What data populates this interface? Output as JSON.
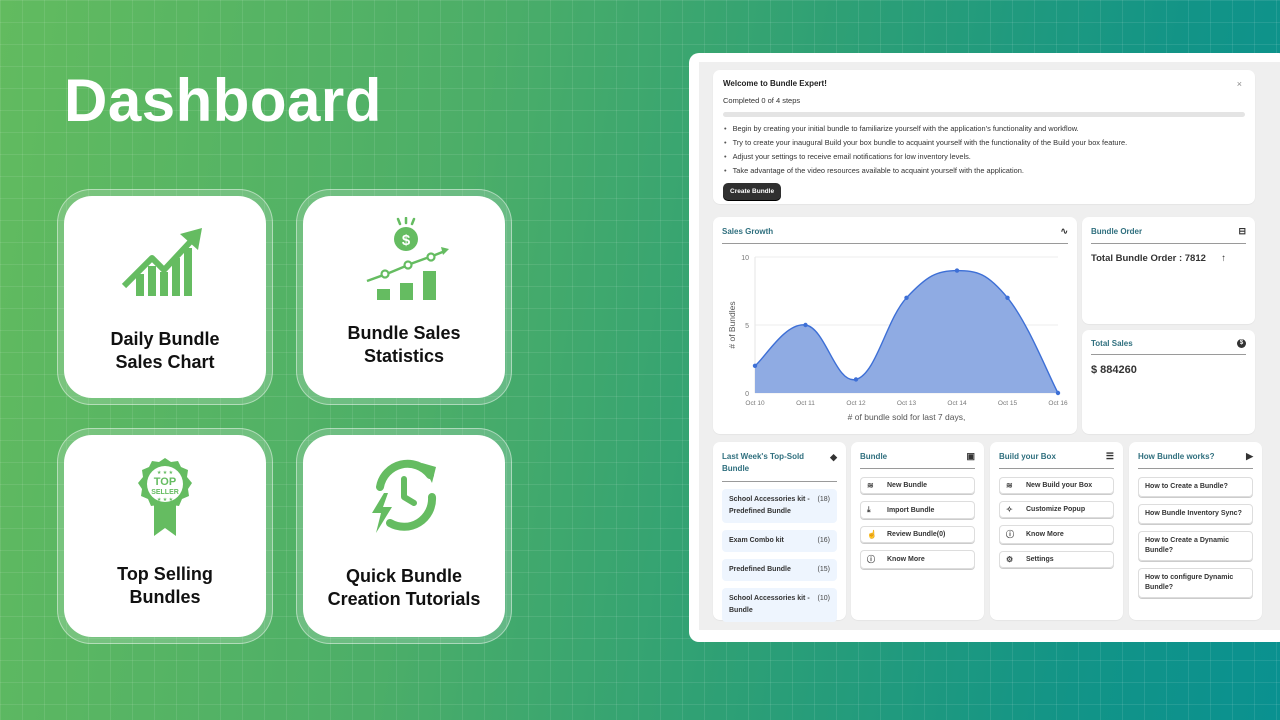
{
  "page": {
    "title": "Dashboard"
  },
  "features": [
    {
      "label_line1": "Daily Bundle",
      "label_line2": "Sales Chart",
      "icon": "growth-chart-icon"
    },
    {
      "label_line1": "Bundle Sales",
      "label_line2": "Statistics",
      "icon": "sales-statistics-icon"
    },
    {
      "label_line1": "Top Selling",
      "label_line2": "Bundles",
      "icon": "top-seller-badge-icon"
    },
    {
      "label_line1": "Quick Bundle",
      "label_line2": "Creation Tutorials",
      "icon": "quick-refresh-icon"
    }
  ],
  "welcome": {
    "title": "Welcome to Bundle Expert!",
    "close_icon": "×",
    "progress_label": "Completed 0 of 4 steps",
    "progress_value": 0,
    "steps": [
      "Begin by creating your initial bundle to familiarize yourself with the application's functionality and workflow.",
      "Try to create your inaugural Build your box bundle to acquaint yourself with the functionality of the Build your box feature.",
      "Adjust your settings to receive email notifications for low inventory levels.",
      "Take advantage of the video resources available to acquaint yourself with the application."
    ],
    "button_label": "Create Bundle"
  },
  "sales_growth": {
    "title": "Sales Growth",
    "icon": "line-chart-icon"
  },
  "chart_data": {
    "type": "area",
    "title": "Sales Growth",
    "categories": [
      "Oct 10",
      "Oct 11",
      "Oct 12",
      "Oct 13",
      "Oct 14",
      "Oct 15",
      "Oct 16"
    ],
    "series": [
      {
        "name": "# of Bundles",
        "values": [
          2,
          5,
          1,
          7,
          9,
          7,
          0
        ],
        "color": "#3d6fd6",
        "fill": "#8fabe3"
      }
    ],
    "xlabel": "# of bundle sold for last 7 days,",
    "ylabel": "# of Bundles",
    "ylim": [
      0,
      10
    ],
    "yticks": [
      "0",
      "5",
      "10"
    ],
    "grid": true,
    "smooth": true
  },
  "bundle_order": {
    "title": "Bundle Order",
    "label": "Total Bundle Order : 7812",
    "trend_icon": "↑"
  },
  "total_sales": {
    "title": "Total Sales",
    "value": "$ 884260"
  },
  "top_sold": {
    "title": "Last Week's Top-Sold Bundle",
    "items": [
      {
        "name": "School Accessories kit - Predefined Bundle",
        "count": "(18)"
      },
      {
        "name": "Exam Combo kit",
        "count": "(16)"
      },
      {
        "name": "Predefined Bundle",
        "count": "(15)"
      },
      {
        "name": "School Accessories kit - Bundle",
        "count": "(10)"
      }
    ]
  },
  "bundle_menu": {
    "title": "Bundle",
    "items": [
      {
        "label": "New Bundle",
        "icon": "stack-icon"
      },
      {
        "label": "Import Bundle",
        "icon": "import-icon"
      },
      {
        "label": "Review Bundle(0)",
        "icon": "thumbs-up-icon"
      },
      {
        "label": "Know More",
        "icon": "info-icon"
      }
    ]
  },
  "byob_menu": {
    "title": "Build your Box",
    "items": [
      {
        "label": "New Build your Box",
        "icon": "stack-icon"
      },
      {
        "label": "Customize Popup",
        "icon": "sparkle-icon"
      },
      {
        "label": "Know More",
        "icon": "info-icon"
      },
      {
        "label": "Settings",
        "icon": "gear-icon"
      }
    ]
  },
  "how_menu": {
    "title": "How Bundle works?",
    "items": [
      {
        "label": "How to Create a Bundle?"
      },
      {
        "label": "How Bundle Inventory Sync?"
      },
      {
        "label": "How to Create a Dynamic Bundle?"
      },
      {
        "label": "How to configure Dynamic Bundle?"
      }
    ]
  },
  "colors": {
    "brand_green": "#62bb5f",
    "heading_teal": "#2f6f7e",
    "chart_line": "#3d6fd6",
    "chart_fill": "#8fabe3"
  }
}
